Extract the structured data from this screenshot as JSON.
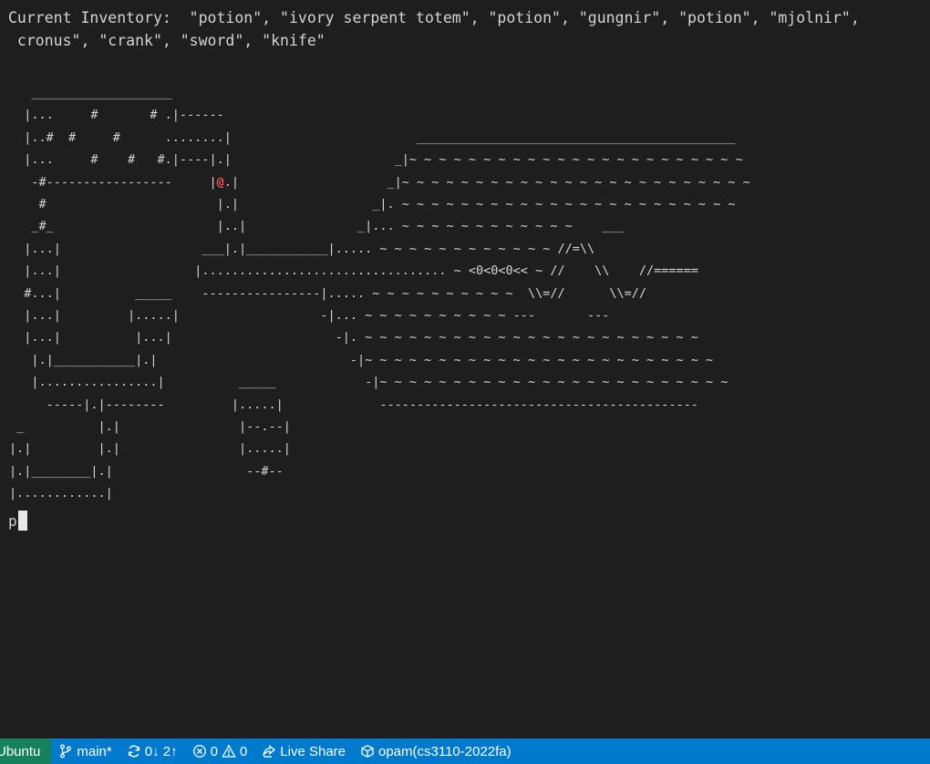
{
  "terminal": {
    "inventory_line_1": "Current Inventory:  \"potion\", \"ivory serpent totem\", \"potion\", \"gungnir\", \"potion\", \"mjolnir\",",
    "inventory_line_2": " cronus\", \"crank\", \"sword\", \"knife\"",
    "map": [
      {
        "pre": "   ___________________",
        "player": "",
        "post": ""
      },
      {
        "pre": "  |...     #       # .|------",
        "player": "",
        "post": ""
      },
      {
        "pre": "  |..#  #     #      ........|",
        "player": "",
        "post": "                         ___________________________________________"
      },
      {
        "pre": "  |...     #    #   #.|----|.|",
        "player": "",
        "post": "                      _|~ ~ ~ ~ ~ ~ ~ ~ ~ ~ ~ ~ ~ ~ ~ ~ ~ ~ ~ ~ ~ ~ ~"
      },
      {
        "pre": "   -#-----------------     |",
        "player": "@",
        "post": ".|                    _|~ ~ ~ ~ ~ ~ ~ ~ ~ ~ ~ ~ ~ ~ ~ ~ ~ ~ ~ ~ ~ ~ ~ ~"
      },
      {
        "pre": "    #                       |.|                  _|. ~ ~ ~ ~ ~ ~ ~ ~ ~ ~ ~ ~ ~ ~ ~ ~ ~ ~ ~ ~ ~ ~ ~",
        "player": "",
        "post": ""
      },
      {
        "pre": "   _#_                      |..|               _|... ~ ~ ~ ~ ~ ~ ~ ~ ~ ~ ~ ~    ___",
        "player": "",
        "post": ""
      },
      {
        "pre": "  |...|                   ___|.|___________|..... ~ ~ ~ ~ ~ ~ ~ ~ ~ ~ ~ ~ //=\\\\",
        "player": "",
        "post": ""
      },
      {
        "pre": "  |...|                  |................................. ~ <0<0<0<< ~ //    \\\\    //======",
        "player": "",
        "post": ""
      },
      {
        "pre": "  #...|          _____    ----------------|..... ~ ~ ~ ~ ~ ~ ~ ~ ~ ~  \\\\=//      \\\\=//",
        "player": "",
        "post": ""
      },
      {
        "pre": "  |...|         |.....|                   -|... ~ ~ ~ ~ ~ ~ ~ ~ ~ ~ ---       ---",
        "player": "",
        "post": ""
      },
      {
        "pre": "  |...|          |...|                      -|. ~ ~ ~ ~ ~ ~ ~ ~ ~ ~ ~ ~ ~ ~ ~ ~ ~ ~ ~ ~ ~ ~ ~",
        "player": "",
        "post": ""
      },
      {
        "pre": "   |.|___________|.|                          -|~ ~ ~ ~ ~ ~ ~ ~ ~ ~ ~ ~ ~ ~ ~ ~ ~ ~ ~ ~ ~ ~ ~ ~",
        "player": "",
        "post": ""
      },
      {
        "pre": "   |................|          _____            -|~ ~ ~ ~ ~ ~ ~ ~ ~ ~ ~ ~ ~ ~ ~ ~ ~ ~ ~ ~ ~ ~ ~ ~",
        "player": "",
        "post": ""
      },
      {
        "pre": "     -----|.|--------         |.....|             -------------------------------------------",
        "player": "",
        "post": ""
      },
      {
        "pre": " _          |.|                |--.--|",
        "player": "",
        "post": ""
      },
      {
        "pre": "|.|         |.|                |.....|",
        "player": "",
        "post": ""
      },
      {
        "pre": "|.|________|.|                  --#--",
        "player": "",
        "post": ""
      },
      {
        "pre": "|............|",
        "player": "",
        "post": ""
      },
      {
        "pre": " ------------",
        "player": "",
        "post": ""
      }
    ],
    "prompt_text": "p"
  },
  "statusbar": {
    "remote_label": "Ubuntu",
    "branch_label": "main*",
    "sync_label": "0↓ 2↑",
    "errors_count": "0",
    "warnings_count": "0",
    "live_share_label": "Live Share",
    "opam_label": "opam(cs3110-2022fa)",
    "colors": {
      "background": "#007acc",
      "remote_background": "#16825d",
      "terminal_background": "#1e1e1e",
      "player_color": "#f14c4c"
    },
    "icons": [
      "git-branch-icon",
      "sync-icon",
      "error-icon",
      "warning-icon",
      "live-share-icon",
      "package-icon"
    ]
  }
}
